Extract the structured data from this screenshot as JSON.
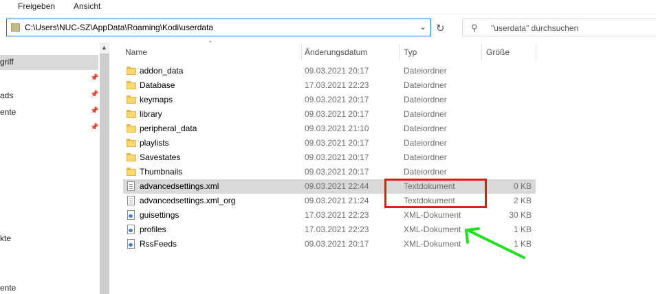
{
  "ribbon": {
    "tabs": [
      "Freigeben",
      "Ansicht"
    ]
  },
  "address": {
    "path": "C:\\Users\\NUC-SZ\\AppData\\Roaming\\Kodi\\userdata"
  },
  "search": {
    "placeholder": "\"userdata\" durchsuchen"
  },
  "nav": {
    "items": [
      {
        "label": "griff",
        "selected": true,
        "pinned": false
      },
      {
        "label": "",
        "pinned": true
      },
      {
        "label": "ads",
        "pinned": true
      },
      {
        "label": "ente",
        "pinned": true
      },
      {
        "label": "",
        "pinned": true
      },
      {
        "label": "kte",
        "pinned": false
      },
      {
        "label": "ente",
        "pinned": false
      }
    ]
  },
  "columns": {
    "name": "Name",
    "date": "Änderungsdatum",
    "type": "Typ",
    "size": "Größe"
  },
  "files": [
    {
      "name": "addon_data",
      "date": "09.03.2021 20:17",
      "type": "Dateiordner",
      "size": "",
      "icon": "folder-icon"
    },
    {
      "name": "Database",
      "date": "17.03.2021 22:23",
      "type": "Dateiordner",
      "size": "",
      "icon": "folder-icon"
    },
    {
      "name": "keymaps",
      "date": "09.03.2021 20:17",
      "type": "Dateiordner",
      "size": "",
      "icon": "folder-icon"
    },
    {
      "name": "library",
      "date": "09.03.2021 20:17",
      "type": "Dateiordner",
      "size": "",
      "icon": "folder-icon"
    },
    {
      "name": "peripheral_data",
      "date": "09.03.2021 21:10",
      "type": "Dateiordner",
      "size": "",
      "icon": "folder-icon"
    },
    {
      "name": "playlists",
      "date": "09.03.2021 20:17",
      "type": "Dateiordner",
      "size": "",
      "icon": "folder-icon"
    },
    {
      "name": "Savestates",
      "date": "09.03.2021 20:17",
      "type": "Dateiordner",
      "size": "",
      "icon": "folder-icon"
    },
    {
      "name": "Thumbnails",
      "date": "09.03.2021 20:17",
      "type": "Dateiordner",
      "size": "",
      "icon": "folder-icon"
    },
    {
      "name": "advancedsettings.xml",
      "date": "09.03.2021 22:44",
      "type": "Textdokument",
      "size": "0 KB",
      "icon": "text-document-icon",
      "selected": true
    },
    {
      "name": "advancedsettings.xml_org",
      "date": "09.03.2021 21:24",
      "type": "Textdokument",
      "size": "2 KB",
      "icon": "text-document-icon"
    },
    {
      "name": "guisettings",
      "date": "17.03.2021 22:23",
      "type": "XML-Dokument",
      "size": "30 KB",
      "icon": "xml-document-icon"
    },
    {
      "name": "profiles",
      "date": "17.03.2021 22:23",
      "type": "XML-Dokument",
      "size": "1 KB",
      "icon": "xml-document-icon"
    },
    {
      "name": "RssFeeds",
      "date": "09.03.2021 20:17",
      "type": "XML-Dokument",
      "size": "1 KB",
      "icon": "xml-document-icon"
    }
  ],
  "annotations": {
    "highlight_color": "#e01b1b",
    "arrow_color": "#1ee01e"
  }
}
